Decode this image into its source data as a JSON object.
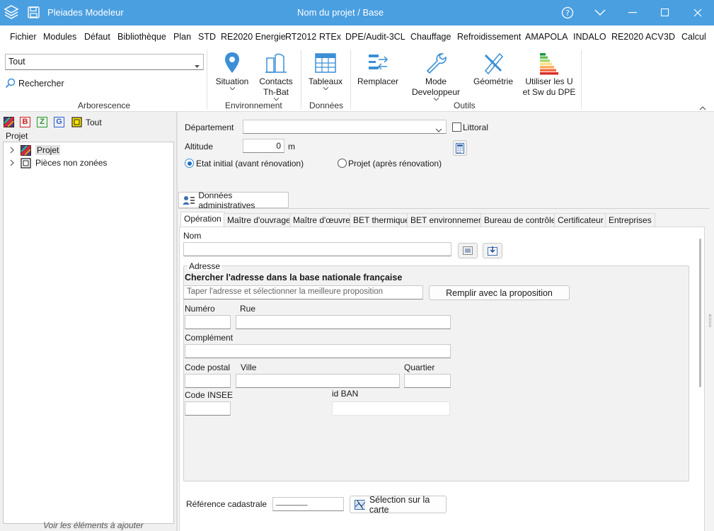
{
  "window": {
    "app_name": "Pleiades Modeleur",
    "title": "Nom du projet / Base"
  },
  "menu": [
    "Fichier",
    "Modules",
    "Défaut",
    "Bibliothèque",
    "Plan",
    "STD",
    "RE2020 Energie",
    "RT2012",
    "RTEx",
    "DPE/Audit-3CL",
    "Chauffage",
    "Refroidissement",
    "AMAPOLA",
    "INDALO",
    "RE2020 ACV",
    "3D",
    "Calcul"
  ],
  "active_menu": "RTEx",
  "ribbon": {
    "filter_value": "Tout",
    "search_label": "Rechercher",
    "group_arborescence": "Arborescence",
    "situation": "Situation",
    "contacts": "Contacts",
    "contacts2": "Th-Bat",
    "group_environnement": "Environnement",
    "tableaux": "Tableaux",
    "group_donnees": "Données",
    "remplacer": "Remplacer",
    "mode": "Mode",
    "mode2": "Developpeur",
    "geometrie": "Géométrie",
    "utiliser": "Utiliser les U",
    "utiliser2": "et Sw du DPE",
    "group_outils": "Outils"
  },
  "left": {
    "toolbar": {
      "b": "B",
      "z": "Z",
      "g": "G",
      "tout": "Tout"
    },
    "header": "Projet",
    "items": [
      "Projet",
      "Pièces non zonées"
    ],
    "footer": "Voir les éléments à ajouter"
  },
  "form": {
    "departement_label": "Département",
    "departement_value": "",
    "littoral_label": "Littoral",
    "altitude_label": "Altitude",
    "altitude_value": "0",
    "altitude_unit": "m",
    "etat_initial": "Etat initial (avant rénovation)",
    "projet_apres": "Projet (après rénovation)",
    "section_tab": "Données administratives",
    "tabs": [
      "Opération",
      "Maître d'ouvrage",
      "Maître d'œuvre",
      "BET thermique",
      "BET environnement",
      "Bureau de contrôle",
      "Certificateur",
      "Entreprises"
    ],
    "nom_label": "Nom",
    "nom_value": "",
    "adresse_legend": "Adresse",
    "search_heading": "Chercher l'adresse dans la base nationale française",
    "search_placeholder": "Taper l'adresse et sélectionner la meilleure proposition",
    "remplir_btn": "Remplir avec la proposition",
    "numero": "Numéro",
    "rue": "Rue",
    "complement": "Complément",
    "code_postal": "Code postal",
    "ville": "Ville",
    "quartier": "Quartier",
    "code_insee": "Code INSEE",
    "id_ban": "id BAN",
    "ref_cadastrale": "Référence cadastrale",
    "ref_value": "________",
    "selection_carte": "Sélection sur la carte"
  },
  "colors": {
    "titlebar": "#4a9fe0",
    "accent": "#3b8fd6"
  }
}
